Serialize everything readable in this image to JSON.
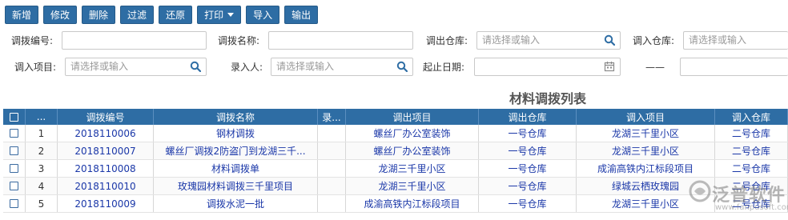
{
  "toolbar": {
    "buttons": [
      "新增",
      "修改",
      "删除",
      "过滤",
      "还原",
      "打印",
      "导入",
      "输出"
    ]
  },
  "filters": {
    "row1": [
      {
        "label": "调拨编号:",
        "value": "",
        "placeholder": ""
      },
      {
        "label": "调拨名称:",
        "value": "",
        "placeholder": ""
      },
      {
        "label": "调出仓库:",
        "value": "",
        "placeholder": "请选择或输入"
      },
      {
        "label": "调入仓库:",
        "value": "",
        "placeholder": "请选择或输入"
      }
    ],
    "row2": [
      {
        "label": "调入项目:",
        "value": "",
        "placeholder": "请选择或输入"
      },
      {
        "label": "录入人:",
        "value": "",
        "placeholder": "请选择或输入"
      },
      {
        "label": "起止日期:",
        "value": "",
        "placeholder": ""
      }
    ],
    "date_separator": "——"
  },
  "table": {
    "title": "材料调拨列表",
    "columns": [
      "",
      "...",
      "调拨编号",
      "调拨名称",
      "录...",
      "调出项目",
      "调出仓库",
      "调入项目",
      "调入仓库"
    ],
    "rows": [
      {
        "no": "1",
        "code": "2018110006",
        "name": "钢材调拨",
        "recorder": "",
        "out_project": "螺丝厂办公室装饰",
        "out_warehouse": "一号仓库",
        "in_project": "龙湖三千里小区",
        "in_warehouse": "二号仓库"
      },
      {
        "no": "2",
        "code": "2018110007",
        "name": "螺丝厂调拨2防盗门到龙湖三千...",
        "recorder": "",
        "out_project": "螺丝厂办公室装饰",
        "out_warehouse": "一号仓库",
        "in_project": "龙湖三千里小区",
        "in_warehouse": "二号仓库"
      },
      {
        "no": "3",
        "code": "2018110008",
        "name": "材料调拨单",
        "recorder": "",
        "out_project": "龙湖三千里小区",
        "out_warehouse": "一号仓库",
        "in_project": "成渝高铁内江标段项目",
        "in_warehouse": "二号仓库"
      },
      {
        "no": "4",
        "code": "2018110010",
        "name": "玫瑰园材料调拨三千里项目",
        "recorder": "",
        "out_project": "龙湖三千里小区",
        "out_warehouse": "一号仓库",
        "in_project": "绿城云栖玫瑰园",
        "in_warehouse": "二号仓库"
      },
      {
        "no": "5",
        "code": "2018110009",
        "name": "调拨水泥一批",
        "recorder": "",
        "out_project": "成渝高铁内江标段项目",
        "out_warehouse": "一号仓库",
        "in_project": "龙湖三千里小区",
        "in_warehouse": "二号仓库"
      }
    ]
  },
  "watermark": {
    "text": "泛普软件",
    "url": "www.fanpusoft.com"
  },
  "colors": {
    "primary": "#2e6da4",
    "link": "#1a37a8",
    "icon": "#2e6da4"
  }
}
